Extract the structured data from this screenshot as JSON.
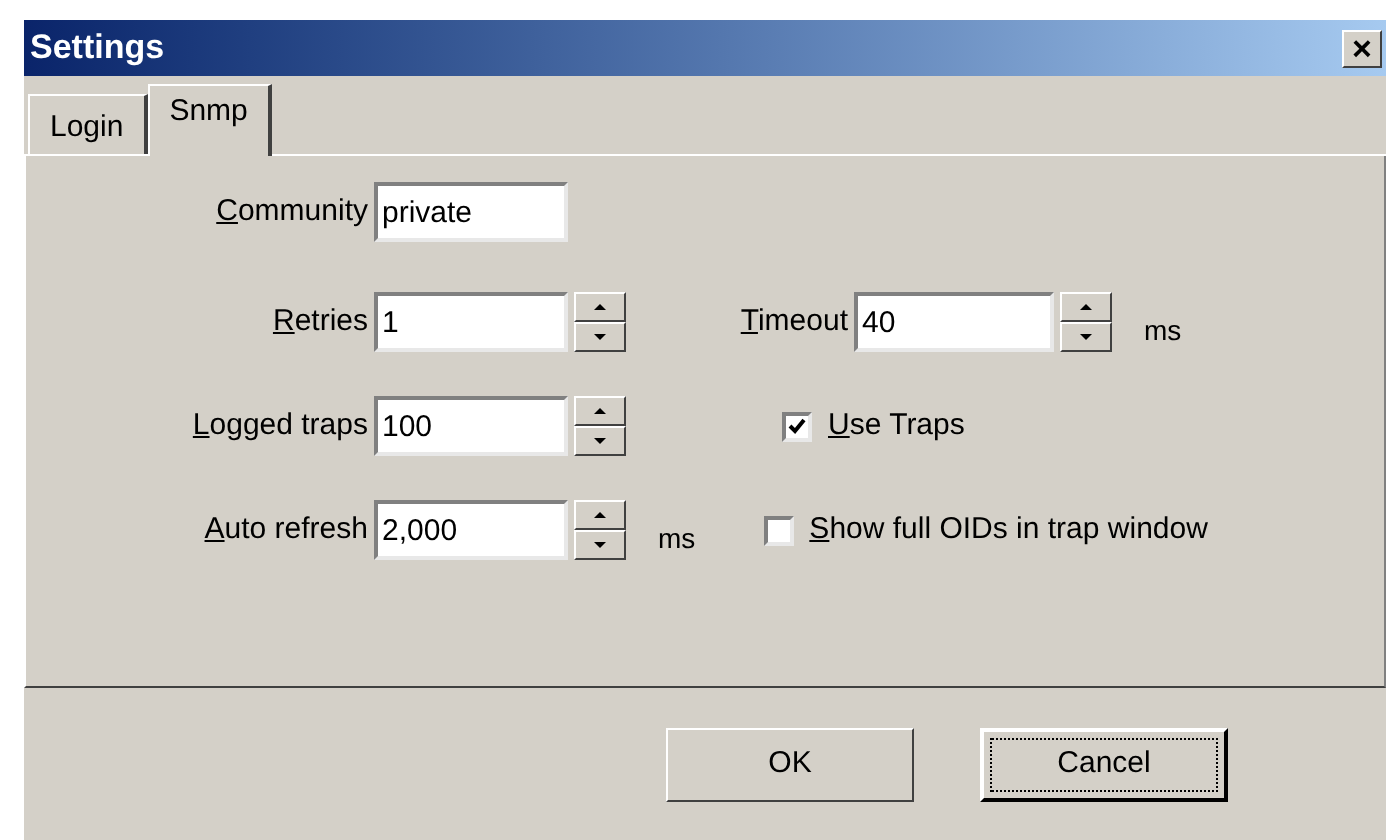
{
  "window": {
    "title": "Settings",
    "close": "×"
  },
  "tabs": [
    {
      "label": "Login",
      "selected": false
    },
    {
      "label": "Snmp",
      "selected": true
    }
  ],
  "community": {
    "label": "Community",
    "underlined_first_letter": true,
    "value": "private"
  },
  "retries": {
    "label": "Retries",
    "underlined_first_letter": true,
    "value": "1"
  },
  "timeout": {
    "label": "Timeout",
    "underlined_first_letter": true,
    "value": "40",
    "unit": "ms"
  },
  "logged_traps": {
    "label": "Logged traps",
    "underlined_first_letter": true,
    "value": "100"
  },
  "auto_refresh": {
    "label": "Auto refresh",
    "underlined_first_letter": true,
    "value": "2,000",
    "unit": "ms"
  },
  "checkboxes": [
    {
      "label": "Use Traps",
      "underlined_first_letter": true,
      "checked": true
    },
    {
      "label": "Show full OIDs in trap window",
      "underlined_first_letter": true,
      "checked": false
    }
  ],
  "buttons": [
    {
      "label": "OK",
      "default": false
    },
    {
      "label": "Cancel",
      "default": true
    }
  ]
}
